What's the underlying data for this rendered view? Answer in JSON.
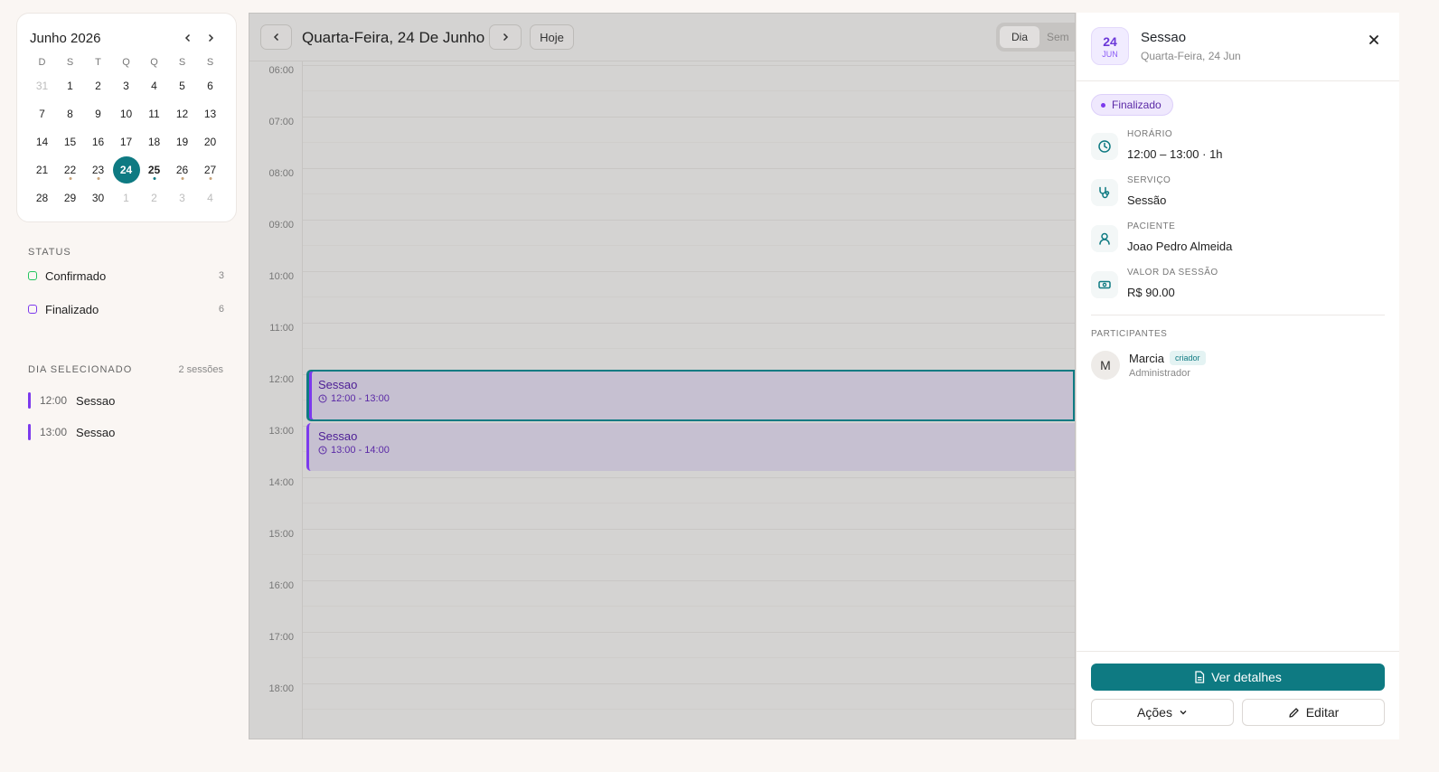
{
  "mini_calendar": {
    "title": "Junho 2026",
    "prev_icon": "chevron-left-icon",
    "next_icon": "chevron-right-icon",
    "weekdays": [
      "D",
      "S",
      "T",
      "Q",
      "Q",
      "S",
      "S"
    ],
    "days": [
      {
        "n": "31",
        "muted": true
      },
      {
        "n": "1"
      },
      {
        "n": "2"
      },
      {
        "n": "3"
      },
      {
        "n": "4"
      },
      {
        "n": "5"
      },
      {
        "n": "6"
      },
      {
        "n": "7"
      },
      {
        "n": "8"
      },
      {
        "n": "9"
      },
      {
        "n": "10"
      },
      {
        "n": "11"
      },
      {
        "n": "12"
      },
      {
        "n": "13"
      },
      {
        "n": "14"
      },
      {
        "n": "15"
      },
      {
        "n": "16"
      },
      {
        "n": "17"
      },
      {
        "n": "18"
      },
      {
        "n": "19"
      },
      {
        "n": "20"
      },
      {
        "n": "21"
      },
      {
        "n": "22",
        "dot": true
      },
      {
        "n": "23",
        "dot": true
      },
      {
        "n": "24",
        "selected": true
      },
      {
        "n": "25",
        "bold": true,
        "dot": true,
        "dot_teal": true
      },
      {
        "n": "26",
        "dot": true
      },
      {
        "n": "27",
        "dot": true
      },
      {
        "n": "28"
      },
      {
        "n": "29"
      },
      {
        "n": "30"
      },
      {
        "n": "1",
        "muted": true
      },
      {
        "n": "2",
        "muted": true
      },
      {
        "n": "3",
        "muted": true
      },
      {
        "n": "4",
        "muted": true
      }
    ]
  },
  "status_section": {
    "label": "STATUS",
    "items": [
      {
        "label": "Confirmado",
        "count": "3",
        "color": "#22c55e"
      },
      {
        "label": "Finalizado",
        "count": "6",
        "color": "#7c3aed"
      }
    ]
  },
  "selected_day": {
    "label": "DIA SELECIONADO",
    "count": "2 sessões",
    "sessions": [
      {
        "time": "12:00",
        "name": "Sessao"
      },
      {
        "time": "13:00",
        "name": "Sessao"
      }
    ]
  },
  "toolbar": {
    "title": "Quarta-Feira, 24 De Junho",
    "today_label": "Hoje",
    "views": [
      "Dia",
      "Sem"
    ]
  },
  "hours": [
    "06:00",
    "07:00",
    "08:00",
    "09:00",
    "10:00",
    "11:00",
    "12:00",
    "13:00",
    "14:00",
    "15:00",
    "16:00",
    "17:00",
    "18:00"
  ],
  "events": [
    {
      "title": "Sessao",
      "time": "12:00 - 13:00",
      "selected": true
    },
    {
      "title": "Sessao",
      "time": "13:00 - 14:00",
      "selected": false
    }
  ],
  "details": {
    "day": "24",
    "month": "JUN",
    "title": "Sessao",
    "subtitle": "Quarta-Feira, 24 Jun",
    "status": "Finalizado",
    "fields": [
      {
        "label": "HORÁRIO",
        "value": "12:00 – 13:00 · 1h",
        "icon": "clock-icon"
      },
      {
        "label": "SERVIÇO",
        "value": "Sessão",
        "icon": "stethoscope-icon"
      },
      {
        "label": "PACIENTE",
        "value": "Joao Pedro Almeida",
        "icon": "user-icon"
      },
      {
        "label": "VALOR DA SESSÃO",
        "value": "R$ 90.00",
        "icon": "banknote-icon"
      }
    ],
    "participants_label": "PARTICIPANTES",
    "participant": {
      "initial": "M",
      "name": "Marcia",
      "tag": "criador",
      "role": "Administrador"
    },
    "primary_action": "Ver detalhes",
    "actions_label": "Ações",
    "edit_label": "Editar"
  },
  "colors": {
    "accent": "#0e7a82",
    "finalizado": "#7c3aed",
    "confirmado": "#22c55e"
  }
}
